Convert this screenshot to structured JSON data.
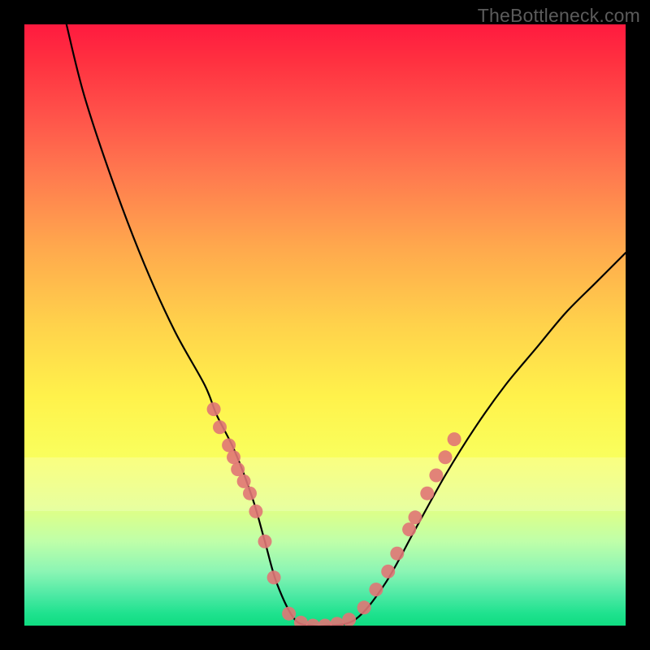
{
  "watermark": "TheBottleneck.com",
  "chart_data": {
    "type": "line",
    "title": "",
    "xlabel": "",
    "ylabel": "",
    "xlim": [
      0,
      100
    ],
    "ylim": [
      0,
      100
    ],
    "series": [
      {
        "name": "curve",
        "x": [
          7,
          10,
          15,
          20,
          25,
          30,
          32,
          35,
          38,
          40,
          42,
          45,
          48,
          50,
          55,
          60,
          65,
          70,
          75,
          80,
          85,
          90,
          95,
          100
        ],
        "y": [
          100,
          88,
          73,
          60,
          49,
          40,
          35,
          29,
          21,
          14,
          7,
          1,
          0,
          0,
          1,
          7,
          16,
          25,
          33,
          40,
          46,
          52,
          57,
          62
        ]
      }
    ],
    "highlight_band_y": [
      19,
      28
    ],
    "markers": {
      "name": "dots",
      "color": "#e07676",
      "points": [
        {
          "x": 31.5,
          "y": 36
        },
        {
          "x": 32.5,
          "y": 33
        },
        {
          "x": 34.0,
          "y": 30
        },
        {
          "x": 34.8,
          "y": 28
        },
        {
          "x": 35.5,
          "y": 26
        },
        {
          "x": 36.5,
          "y": 24
        },
        {
          "x": 37.5,
          "y": 22
        },
        {
          "x": 38.5,
          "y": 19
        },
        {
          "x": 40.0,
          "y": 14
        },
        {
          "x": 41.5,
          "y": 8
        },
        {
          "x": 44.0,
          "y": 2
        },
        {
          "x": 46.0,
          "y": 0.5
        },
        {
          "x": 48.0,
          "y": 0
        },
        {
          "x": 50.0,
          "y": 0
        },
        {
          "x": 52.0,
          "y": 0.3
        },
        {
          "x": 54.0,
          "y": 1
        },
        {
          "x": 56.5,
          "y": 3
        },
        {
          "x": 58.5,
          "y": 6
        },
        {
          "x": 60.5,
          "y": 9
        },
        {
          "x": 62.0,
          "y": 12
        },
        {
          "x": 64.0,
          "y": 16
        },
        {
          "x": 65.0,
          "y": 18
        },
        {
          "x": 67.0,
          "y": 22
        },
        {
          "x": 68.5,
          "y": 25
        },
        {
          "x": 70.0,
          "y": 28
        },
        {
          "x": 71.5,
          "y": 31
        }
      ]
    }
  }
}
